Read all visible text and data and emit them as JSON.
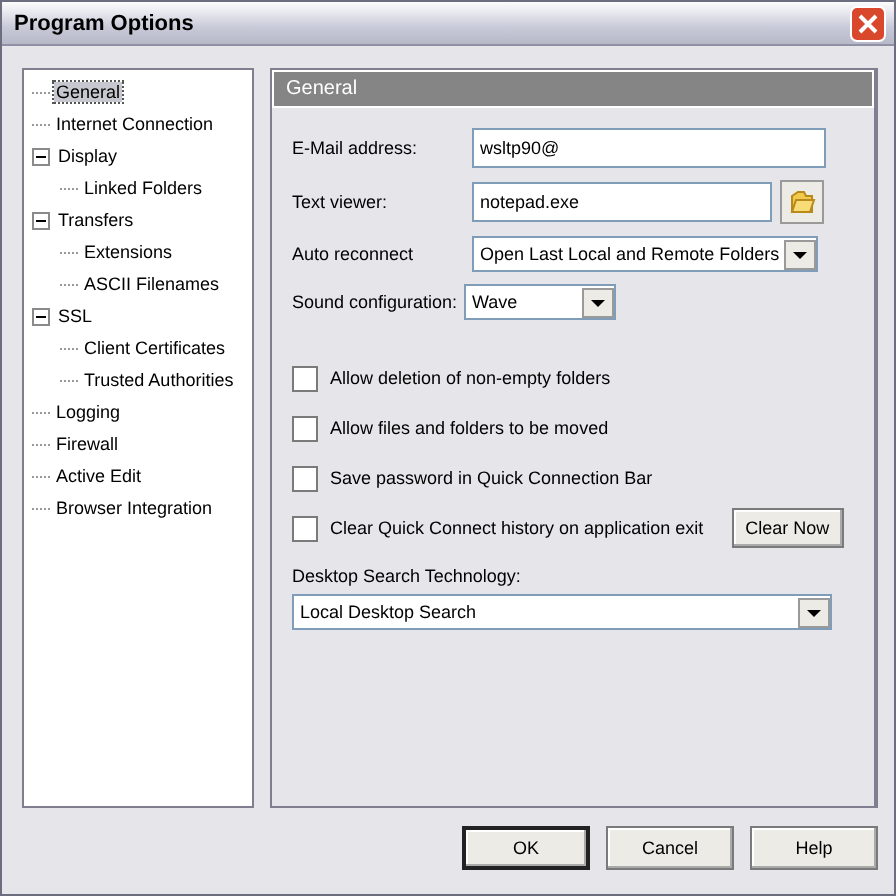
{
  "window": {
    "title": "Program Options"
  },
  "tree": [
    {
      "label": "General",
      "selected": true
    },
    {
      "label": "Internet Connection",
      "selected": false
    },
    {
      "label": "Display",
      "selected": false,
      "expanded": true,
      "children": [
        {
          "label": "Linked Folders",
          "selected": false
        }
      ]
    },
    {
      "label": "Transfers",
      "selected": false,
      "expanded": true,
      "children": [
        {
          "label": "Extensions",
          "selected": false
        },
        {
          "label": "ASCII Filenames",
          "selected": false
        }
      ]
    },
    {
      "label": "SSL",
      "selected": false,
      "expanded": true,
      "children": [
        {
          "label": "Client Certificates",
          "selected": false
        },
        {
          "label": "Trusted Authorities",
          "selected": false
        }
      ]
    },
    {
      "label": "Logging",
      "selected": false
    },
    {
      "label": "Firewall",
      "selected": false
    },
    {
      "label": "Active Edit",
      "selected": false
    },
    {
      "label": "Browser Integration",
      "selected": false
    }
  ],
  "panel": {
    "title": "General",
    "fields": [
      {
        "kind": "text",
        "label": "E-Mail address:",
        "value": "wsltp90@"
      },
      {
        "kind": "file",
        "label": "Text viewer:",
        "value": "notepad.exe"
      },
      {
        "kind": "dropdown",
        "label": "Auto reconnect",
        "value": "Open Last Local and Remote Folders"
      },
      {
        "kind": "dropdown",
        "label": "Sound configuration:",
        "value": "Wave"
      }
    ],
    "checkboxes": [
      {
        "label": "Allow deletion of non-empty folders",
        "checked": false
      },
      {
        "label": "Allow files and folders to be moved",
        "checked": false
      },
      {
        "label": "Save password in Quick Connection Bar",
        "checked": false
      },
      {
        "label": "Clear Quick Connect history on application exit",
        "checked": false,
        "button": "Clear Now"
      }
    ],
    "search": {
      "label": "Desktop Search Technology:",
      "value": "Local Desktop Search"
    }
  },
  "buttons": [
    "OK",
    "Cancel",
    "Help"
  ]
}
